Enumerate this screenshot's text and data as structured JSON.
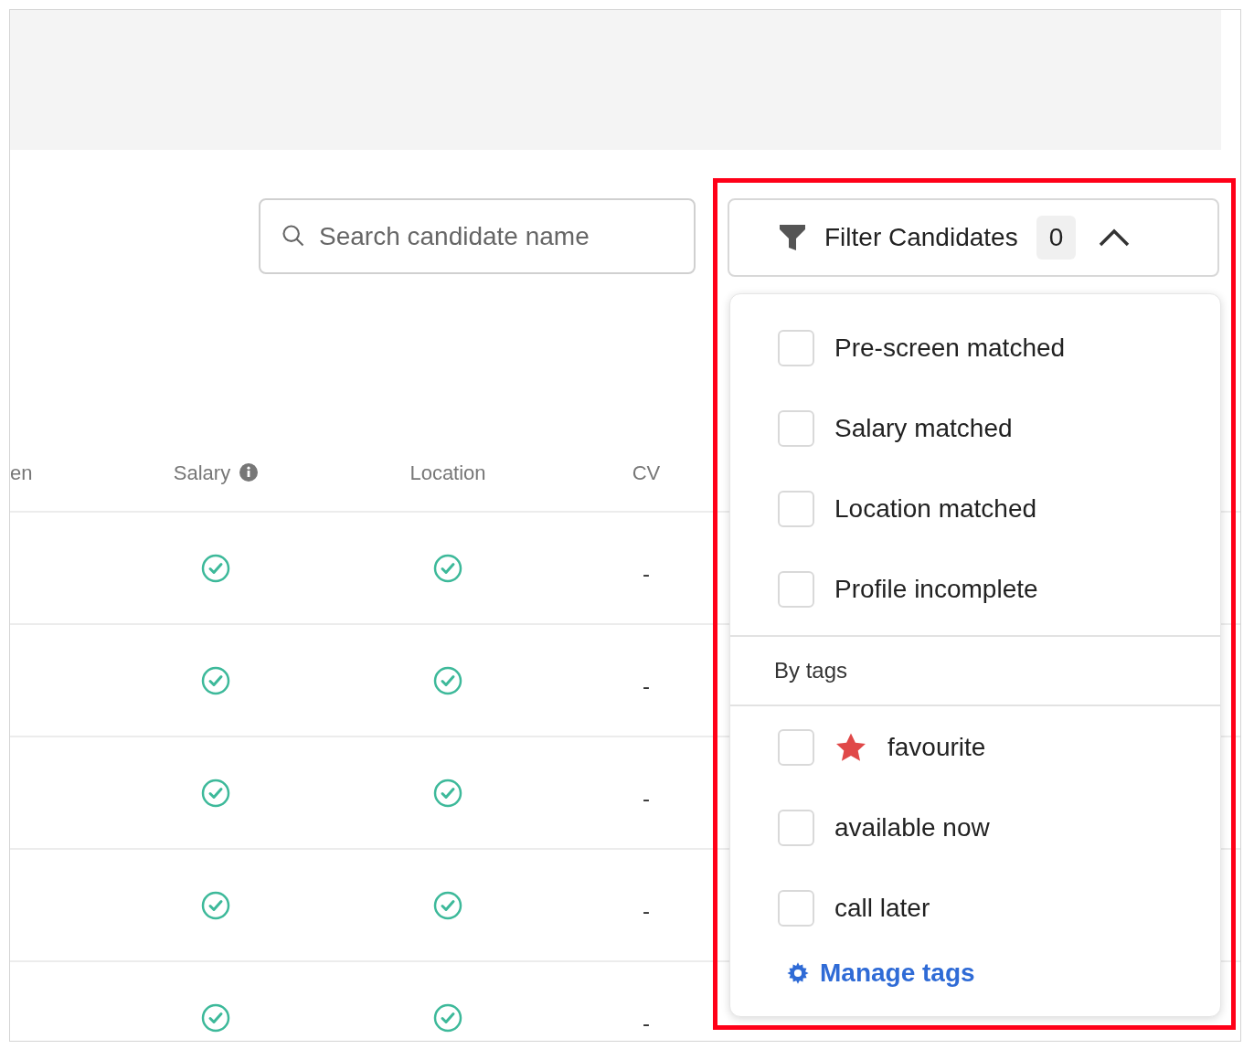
{
  "search": {
    "placeholder": "Search candidate name"
  },
  "filter_button": {
    "label": "Filter Candidates",
    "count": "0",
    "expanded": true
  },
  "table": {
    "columns": [
      {
        "label": "en",
        "info": false
      },
      {
        "label": "Salary",
        "info": true
      },
      {
        "label": "Location",
        "info": false
      },
      {
        "label": "CV",
        "info": false
      }
    ],
    "rows": [
      {
        "salary_matched": true,
        "location_matched": true,
        "cv": "-"
      },
      {
        "salary_matched": true,
        "location_matched": true,
        "cv": "-"
      },
      {
        "salary_matched": true,
        "location_matched": true,
        "cv": "-"
      },
      {
        "salary_matched": true,
        "location_matched": true,
        "cv": "-"
      },
      {
        "salary_matched": true,
        "location_matched": true,
        "cv": "-"
      }
    ]
  },
  "filter_menu": {
    "options": [
      {
        "label": "Pre-screen matched",
        "checked": false
      },
      {
        "label": "Salary matched",
        "checked": false
      },
      {
        "label": "Location matched",
        "checked": false
      },
      {
        "label": "Profile incomplete",
        "checked": false
      }
    ],
    "tags_heading": "By tags",
    "tags": [
      {
        "label": "favourite",
        "checked": false,
        "starred": true
      },
      {
        "label": "available now",
        "checked": false,
        "starred": false
      },
      {
        "label": "call later",
        "checked": false,
        "starred": false
      }
    ],
    "manage_link": "Manage tags"
  },
  "highlight": true
}
